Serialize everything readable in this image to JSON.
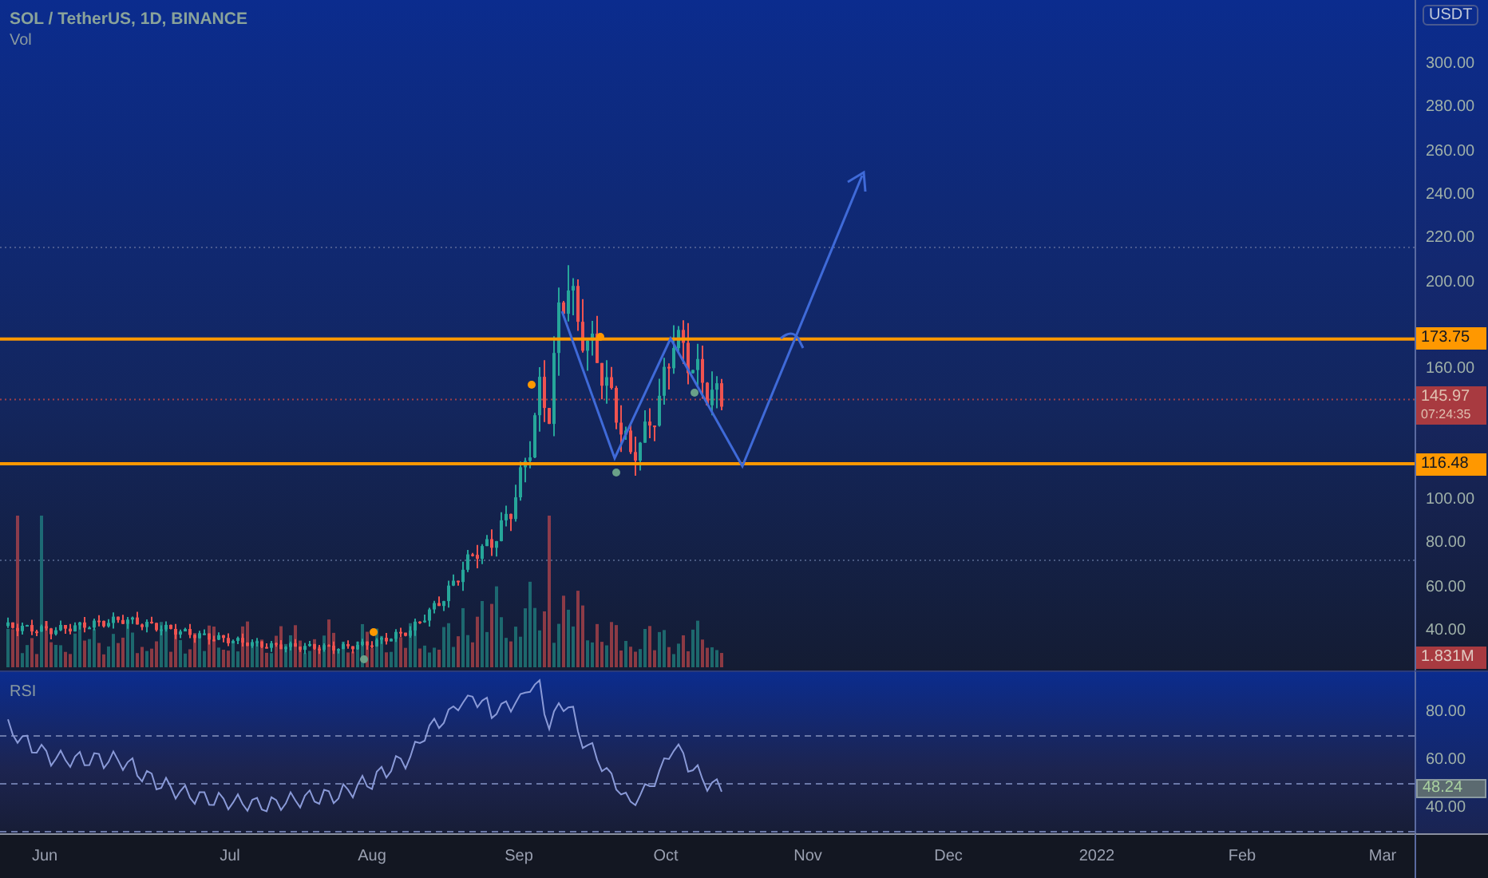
{
  "chart": {
    "title": "SOL / TetherUS, 1D, BINANCE",
    "indicator": "Vol"
  },
  "price_axis": {
    "currency": "USDT",
    "ticks": [
      "300.00",
      "280.00",
      "260.00",
      "240.00",
      "220.00",
      "200.00",
      "160.00",
      "100.00",
      "80.00",
      "60.00",
      "40.00"
    ]
  },
  "price_labels": [
    {
      "kind": "level",
      "text": "173.75"
    },
    {
      "kind": "last",
      "text": "145.97",
      "countdown": "07:24:35"
    },
    {
      "kind": "level",
      "text": "116.48"
    },
    {
      "kind": "volume",
      "text": "1.831M"
    }
  ],
  "rsi": {
    "title": "RSI",
    "ticks": [
      "80.00",
      "60.00",
      "40.00"
    ],
    "value": "48.24"
  },
  "time_axis": {
    "labels": [
      "Jun",
      "Jul",
      "Aug",
      "Sep",
      "Oct",
      "Nov",
      "Dec",
      "2022",
      "Feb",
      "Mar"
    ]
  }
}
